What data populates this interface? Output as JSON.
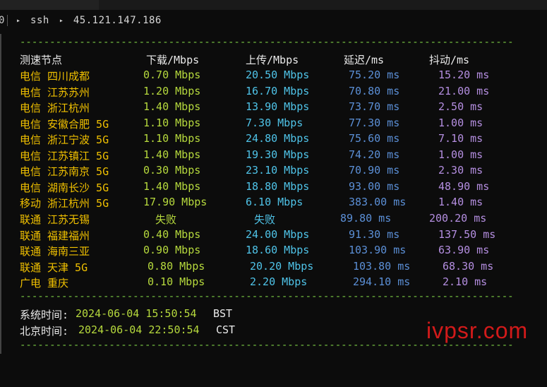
{
  "breadcrumb": {
    "edge": "0",
    "arrow_glyph": "▸",
    "segments": [
      "ssh",
      "45.121.147.186"
    ]
  },
  "divider": "----------------------------------------------------------------------------------------",
  "table": {
    "headers": [
      "测速节点",
      "下载/Mbps",
      "上传/Mbps",
      "延迟/ms",
      "抖动/ms"
    ],
    "rows": [
      [
        "电信 四川成都",
        "0.70 Mbps",
        "20.50 Mbps",
        "75.20 ms",
        "15.20 ms"
      ],
      [
        "电信 江苏苏州",
        "1.20 Mbps",
        "16.70 Mbps",
        "70.80 ms",
        "21.00 ms"
      ],
      [
        "电信 浙江杭州",
        "1.40 Mbps",
        "13.90 Mbps",
        "73.70 ms",
        "2.50 ms"
      ],
      [
        "电信 安徽合肥 5G",
        "1.10 Mbps",
        "7.30 Mbps",
        "77.30 ms",
        "1.00 ms"
      ],
      [
        "电信 浙江宁波 5G",
        "1.10 Mbps",
        "24.80 Mbps",
        "75.60 ms",
        "7.10 ms"
      ],
      [
        "电信 江苏镇江 5G",
        "1.40 Mbps",
        "19.30 Mbps",
        "74.20 ms",
        "1.00 ms"
      ],
      [
        "电信 江苏南京 5G",
        "0.30 Mbps",
        "23.10 Mbps",
        "70.90 ms",
        "2.30 ms"
      ],
      [
        "电信 湖南长沙 5G",
        "1.40 Mbps",
        "18.80 Mbps",
        "93.00 ms",
        "48.90 ms"
      ],
      [
        "移动 浙江杭州 5G",
        "17.90 Mbps",
        "6.10 Mbps",
        "383.00 ms",
        "1.40 ms"
      ],
      [
        "联通 江苏无锡",
        "失败",
        "失败",
        "89.80 ms",
        "200.20 ms"
      ],
      [
        "联通 福建福州",
        "0.40 Mbps",
        "24.00 Mbps",
        "91.30 ms",
        "137.50 ms"
      ],
      [
        "联通 海南三亚",
        "0.90 Mbps",
        "18.60 Mbps",
        "103.90 ms",
        "63.90 ms"
      ],
      [
        "联通 天津 5G",
        "0.80 Mbps",
        "20.20 Mbps",
        "103.80 ms",
        "68.30 ms"
      ],
      [
        "广电 重庆",
        "0.10 Mbps",
        "2.20 Mbps",
        "294.10 ms",
        "2.10 ms"
      ]
    ]
  },
  "system_time": {
    "label": "系统时间:",
    "value": "2024-06-04 15:50:54",
    "tz": "BST"
  },
  "beijing_time": {
    "label": "北京时间:",
    "value": "2024-06-04 22:50:54",
    "tz": "CST"
  },
  "watermark": "ivpsr.com",
  "colors": {
    "node": "#f0c000",
    "download": "#b6d93d",
    "upload": "#4fc3e8",
    "latency": "#5b8fd6",
    "jitter": "#b48ee0",
    "divider": "#7ac943",
    "watermark": "#d11a1a"
  }
}
